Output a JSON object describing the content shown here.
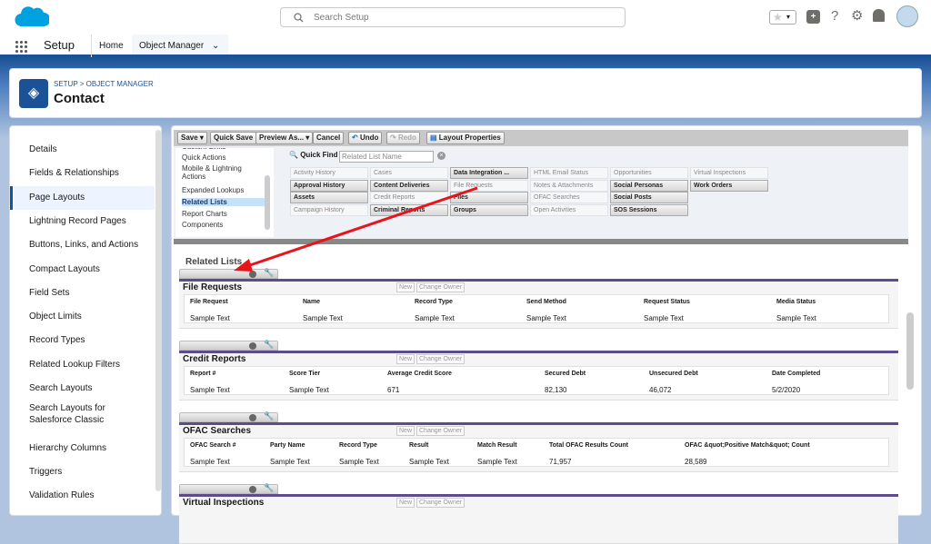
{
  "header": {
    "search_placeholder": "Search Setup",
    "app_name": "Setup",
    "tabs": [
      "Home",
      "Object Manager"
    ]
  },
  "page": {
    "breadcrumb": "SETUP > OBJECT MANAGER",
    "title": "Contact"
  },
  "sidebar": {
    "items": [
      "Details",
      "Fields & Relationships",
      "Page Layouts",
      "Lightning Record Pages",
      "Buttons, Links, and Actions",
      "Compact Layouts",
      "Field Sets",
      "Object Limits",
      "Record Types",
      "Related Lookup Filters",
      "Search Layouts",
      "Search Layouts for Salesforce Classic",
      "Hierarchy Columns",
      "Triggers",
      "Validation Rules"
    ],
    "active": "Page Layouts"
  },
  "toolbar": {
    "save": "Save",
    "quick_save": "Quick Save",
    "preview": "Preview As...",
    "cancel": "Cancel",
    "undo": "Undo",
    "redo": "Redo",
    "layout_properties": "Layout Properties"
  },
  "palette": {
    "categories": [
      "Custom Links",
      "Quick Actions",
      "Mobile & Lightning Actions",
      "Expanded Lookups",
      "Related Lists",
      "Report Charts",
      "Components"
    ],
    "active_category": "Related Lists",
    "quick_find_label": "Quick Find",
    "quick_find_placeholder": "Related List Name",
    "columns": [
      [
        {
          "t": "Activity History",
          "on": false
        },
        {
          "t": "Approval History",
          "on": true
        },
        {
          "t": "Assets",
          "on": true
        },
        {
          "t": "Campaign History",
          "on": false
        }
      ],
      [
        {
          "t": "Cases",
          "on": false
        },
        {
          "t": "Content Deliveries",
          "on": true
        },
        {
          "t": "Credit Reports",
          "on": false
        },
        {
          "t": "Criminal Reports",
          "on": true
        }
      ],
      [
        {
          "t": "Data Integration ...",
          "on": true
        },
        {
          "t": "File Requests",
          "on": false
        },
        {
          "t": "Files",
          "on": true
        },
        {
          "t": "Groups",
          "on": true
        }
      ],
      [
        {
          "t": "HTML Email Status",
          "on": false
        },
        {
          "t": "Notes & Attachments",
          "on": false
        },
        {
          "t": "OFAC Searches",
          "on": false
        },
        {
          "t": "Open Activities",
          "on": false
        }
      ],
      [
        {
          "t": "Opportunities",
          "on": false
        },
        {
          "t": "Social Personas",
          "on": true
        },
        {
          "t": "Social Posts",
          "on": true
        },
        {
          "t": "SOS Sessions",
          "on": true
        }
      ],
      [
        {
          "t": "Virtual Inspections",
          "on": false
        },
        {
          "t": "Work Orders",
          "on": true
        }
      ]
    ]
  },
  "related_lists_title": "Related Lists",
  "buttons": {
    "new": "New",
    "change_owner": "Change Owner"
  },
  "sections": [
    {
      "title": "File Requests",
      "headers": [
        "File Request",
        "Name",
        "Record Type",
        "Send Method",
        "Request Status",
        "Media Status"
      ],
      "values": [
        "Sample Text",
        "Sample Text",
        "Sample Text",
        "Sample Text",
        "Sample Text",
        "Sample Text"
      ]
    },
    {
      "title": "Credit Reports",
      "headers": [
        "Report #",
        "Score Tier",
        "Average Credit Score",
        "Secured Debt",
        "Unsecured Debt",
        "Date Completed"
      ],
      "values": [
        "Sample Text",
        "Sample Text",
        "671",
        "82,130",
        "46,072",
        "5/2/2020"
      ]
    },
    {
      "title": "OFAC Searches",
      "headers": [
        "OFAC Search #",
        "Party Name",
        "Record Type",
        "Result",
        "Match Result",
        "Total OFAC Results Count",
        "OFAC &quot;Positive Match&quot; Count"
      ],
      "values": [
        "Sample Text",
        "Sample Text",
        "Sample Text",
        "Sample Text",
        "Sample Text",
        "71,957",
        "28,589"
      ]
    },
    {
      "title": "Virtual Inspections",
      "headers": [],
      "values": []
    }
  ],
  "colors": {
    "brand": "#1b5297",
    "section_border": "#5e4b8b",
    "arrow": "#e8141b"
  }
}
